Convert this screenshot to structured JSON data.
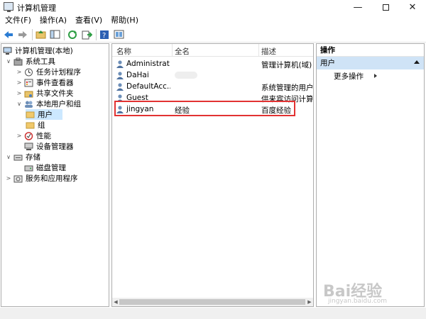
{
  "window": {
    "title": "计算机管理",
    "min": "—",
    "close": "✕"
  },
  "menu": [
    "文件(F)",
    "操作(A)",
    "查看(V)",
    "帮助(H)"
  ],
  "tree": {
    "root": "计算机管理(本地)",
    "system_tools": "系统工具",
    "task_scheduler": "任务计划程序",
    "event_viewer": "事件查看器",
    "shared_folders": "共享文件夹",
    "local_users_groups": "本地用户和组",
    "users": "用户",
    "groups": "组",
    "performance": "性能",
    "device_manager": "设备管理器",
    "storage": "存储",
    "disk_management": "磁盘管理",
    "services_apps": "服务和应用程序"
  },
  "columns": {
    "name": "名称",
    "full_name": "全名",
    "description": "描述"
  },
  "users": [
    {
      "name": "Administrat...",
      "full_name": "",
      "description": "管理计算机(域)的"
    },
    {
      "name": "DaHai",
      "full_name": "",
      "description": ""
    },
    {
      "name": "DefaultAcc...",
      "full_name": "",
      "description": "系统管理的用户帐"
    },
    {
      "name": "Guest",
      "full_name": "",
      "description": "供来宾访问计算机"
    },
    {
      "name": "jingyan",
      "full_name": "经验",
      "description": "百度经验"
    }
  ],
  "actions": {
    "header": "操作",
    "section": "用户",
    "more": "更多操作"
  },
  "watermark": {
    "brand": "Bai经验",
    "url": "jingyan.baidu.com"
  },
  "colors": {
    "selection": "#cce8ff",
    "highlight_border": "#e23232",
    "action_band": "#cfe3f6"
  }
}
